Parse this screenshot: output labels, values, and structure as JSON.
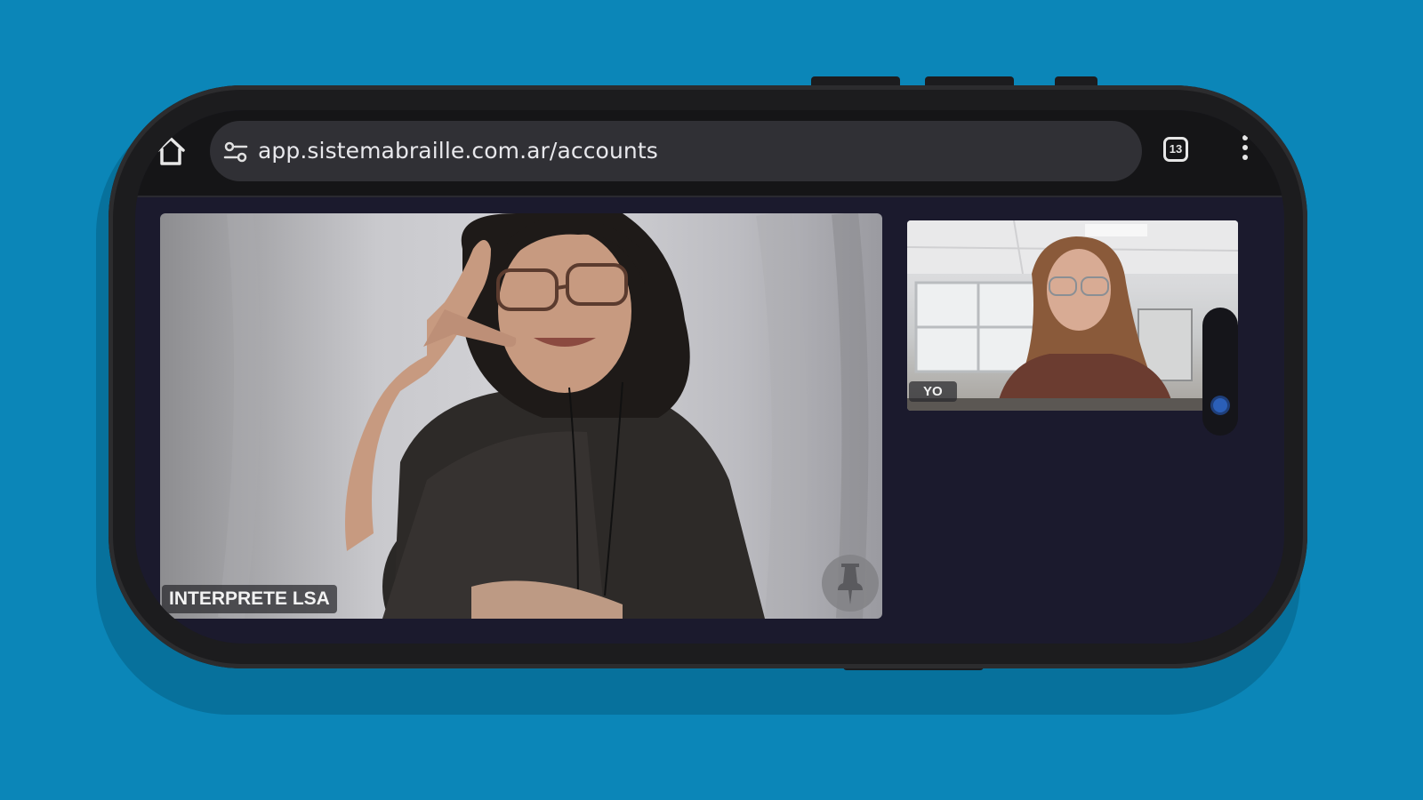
{
  "browser": {
    "url": "app.sistemabraille.com.ar/accounts",
    "tab_count": "13",
    "icons": {
      "home": "home-icon",
      "site_settings": "tune-icon",
      "tabs": "tabs-icon",
      "menu": "more-vert-icon"
    }
  },
  "call": {
    "main_tile": {
      "label": "INTERPRETE LSA",
      "action_icon": "pin-icon"
    },
    "self_tile": {
      "label": "YO"
    }
  },
  "colors": {
    "background": "#0b86b8",
    "screen": "#1b1a2d",
    "address_bar": "#303035"
  }
}
